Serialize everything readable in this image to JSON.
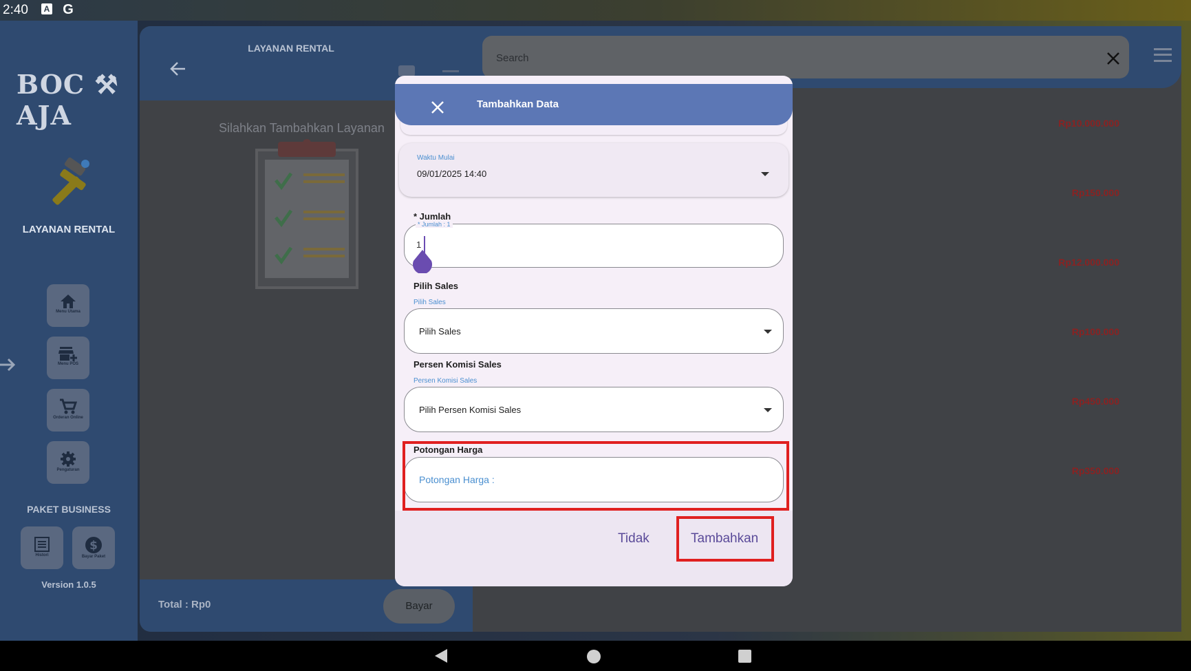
{
  "status_bar": {
    "time": "2:40",
    "icons": [
      "a-icon",
      "google-icon"
    ]
  },
  "sidebar": {
    "brand": "BOC ⚒ AJA",
    "title": "LAYANAN RENTAL",
    "items": [
      {
        "label": "Menu Utama",
        "icon": "home-icon"
      },
      {
        "label": "Menu POS",
        "icon": "store-add-icon"
      },
      {
        "label": "Orderan Online",
        "icon": "cart-icon"
      },
      {
        "label": "Pengaturan",
        "icon": "gear-icon"
      }
    ],
    "paket_title": "PAKET BUSINESS",
    "paket_items": [
      {
        "label": "Histori",
        "icon": "list-icon"
      },
      {
        "label": "Bayar Paket",
        "icon": "dollar-icon"
      }
    ],
    "version": "Version 1.0.5"
  },
  "middle": {
    "title": "LAYANAN RENTAL",
    "empty_text": "Silahkan Tambahkan Layanan",
    "total_label": "Total :  Rp0",
    "pay_button": "Bayar"
  },
  "right": {
    "search_placeholder": "Search",
    "prices": [
      "Rp10.000.000",
      "Rp150.000",
      "Rp12.000.000",
      "Rp100.000",
      "Rp450.000",
      "Rp350.000"
    ]
  },
  "dialog": {
    "title": "Tambahkan Data",
    "start_time": {
      "label": "Waktu Mulai",
      "value": "09/01/2025 14:40"
    },
    "jumlah": {
      "section_label": "* Jumlah",
      "float_label": "* Jumlah : 1",
      "value": "1"
    },
    "sales": {
      "section_label": "Pilih Sales",
      "float_label": "Pilih Sales",
      "value": "Pilih Sales"
    },
    "komisi": {
      "section_label": "Persen Komisi Sales",
      "float_label": "Persen Komisi Sales",
      "value": "Pilih Persen Komisi Sales"
    },
    "potongan": {
      "section_label": "Potongan Harga",
      "placeholder": "Potongan Harga :"
    },
    "buttons": {
      "cancel": "Tidak",
      "confirm": "Tambahkan"
    }
  },
  "colors": {
    "header_blue": "#5c77b5",
    "price_red": "#8a2222",
    "highlight_red": "#e02020",
    "action_purple": "#5a4a99",
    "label_blue": "#4a8fd0"
  }
}
